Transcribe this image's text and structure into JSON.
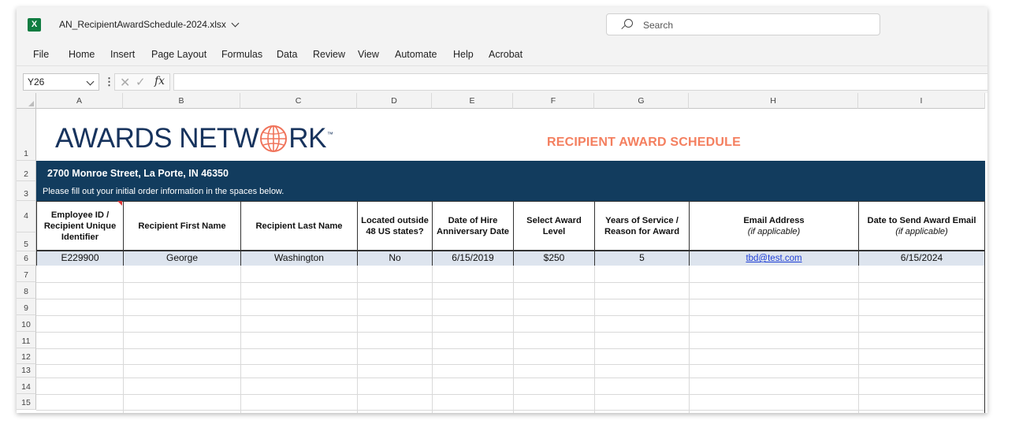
{
  "app": {
    "file_name": "AN_RecipientAwardSchedule-2024.xlsx",
    "search_placeholder": "Search",
    "logo_letter": "X",
    "accent_color": "#107c41"
  },
  "ribbon": {
    "tabs": [
      "File",
      "Home",
      "Insert",
      "Page Layout",
      "Formulas",
      "Data",
      "Review",
      "View",
      "Automate",
      "Help",
      "Acrobat"
    ]
  },
  "formula_bar": {
    "name_box": "Y26",
    "fx_label": "fx",
    "formula": ""
  },
  "sheet": {
    "columns": [
      "A",
      "B",
      "C",
      "D",
      "E",
      "F",
      "G",
      "H",
      "I"
    ],
    "rows": [
      "1",
      "2",
      "3",
      "4",
      "5",
      "6",
      "7",
      "8",
      "9",
      "10",
      "11",
      "12",
      "13",
      "14",
      "15"
    ],
    "logo_left": "AWARDS NETW",
    "logo_right": "RK",
    "logo_tm": "™",
    "title": "RECIPIENT AWARD SCHEDULE",
    "title_color": "#f47f5f",
    "band_color": "#123c5e",
    "address": "2700 Monroe Street, La Porte, IN 46350",
    "instructions": "Please fill out your initial order information in the spaces below.",
    "headers": [
      {
        "line1": "Employee ID /",
        "line2": "Recipient Unique",
        "line3": "Identifier"
      },
      {
        "line1": "Recipient First Name"
      },
      {
        "line1": "Recipient Last Name"
      },
      {
        "line1": "Located outside",
        "line2": "48 US states?"
      },
      {
        "line1": "Date of Hire",
        "line2": "Anniversary Date"
      },
      {
        "line1": "Select Award",
        "line2": "Level"
      },
      {
        "line1": "Years of Service /",
        "line2": "Reason for Award"
      },
      {
        "line1": "Email Address",
        "sub": "(if applicable)"
      },
      {
        "line1": "Date to Send Award Email",
        "sub": "(if applicable)"
      }
    ],
    "data_row": [
      "E229900",
      "George",
      "Washington",
      "No",
      "6/15/2019",
      "$250",
      "5",
      "tbd@test.com",
      "6/15/2024"
    ]
  }
}
